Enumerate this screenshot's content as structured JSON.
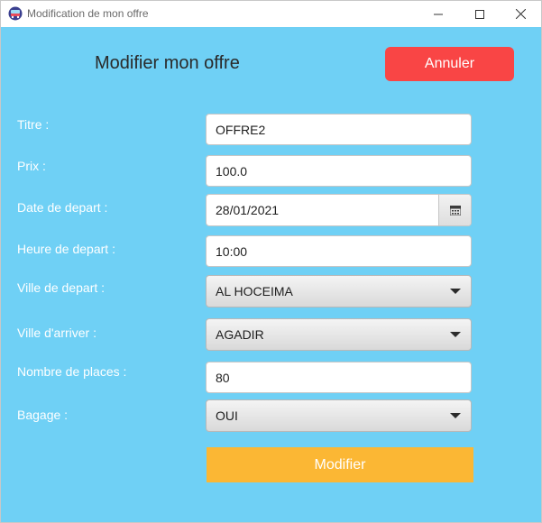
{
  "window": {
    "title": "Modification de mon offre",
    "app_icon": "bus-icon"
  },
  "header": {
    "title": "Modifier mon offre",
    "cancel_label": "Annuler"
  },
  "form": {
    "titre": {
      "label": "Titre :",
      "value": "OFFRE2"
    },
    "prix": {
      "label": "Prix :",
      "value": "100.0"
    },
    "date_depart": {
      "label": "Date de depart :",
      "value": "28/01/2021",
      "icon": "calendar-icon"
    },
    "heure_depart": {
      "label": "Heure de depart :",
      "value": "10:00"
    },
    "ville_depart": {
      "label": "Ville de depart :",
      "value": "AL HOCEIMA"
    },
    "ville_arriver": {
      "label": "Ville d'arriver :",
      "value": "AGADIR"
    },
    "nombre_places": {
      "label": "Nombre de places :",
      "value": "80"
    },
    "bagage": {
      "label": "Bagage :",
      "value": "OUI"
    },
    "submit_label": "Modifier"
  },
  "colors": {
    "background": "#6fd0f5",
    "cancel": "#f94545",
    "submit": "#fbb734"
  }
}
